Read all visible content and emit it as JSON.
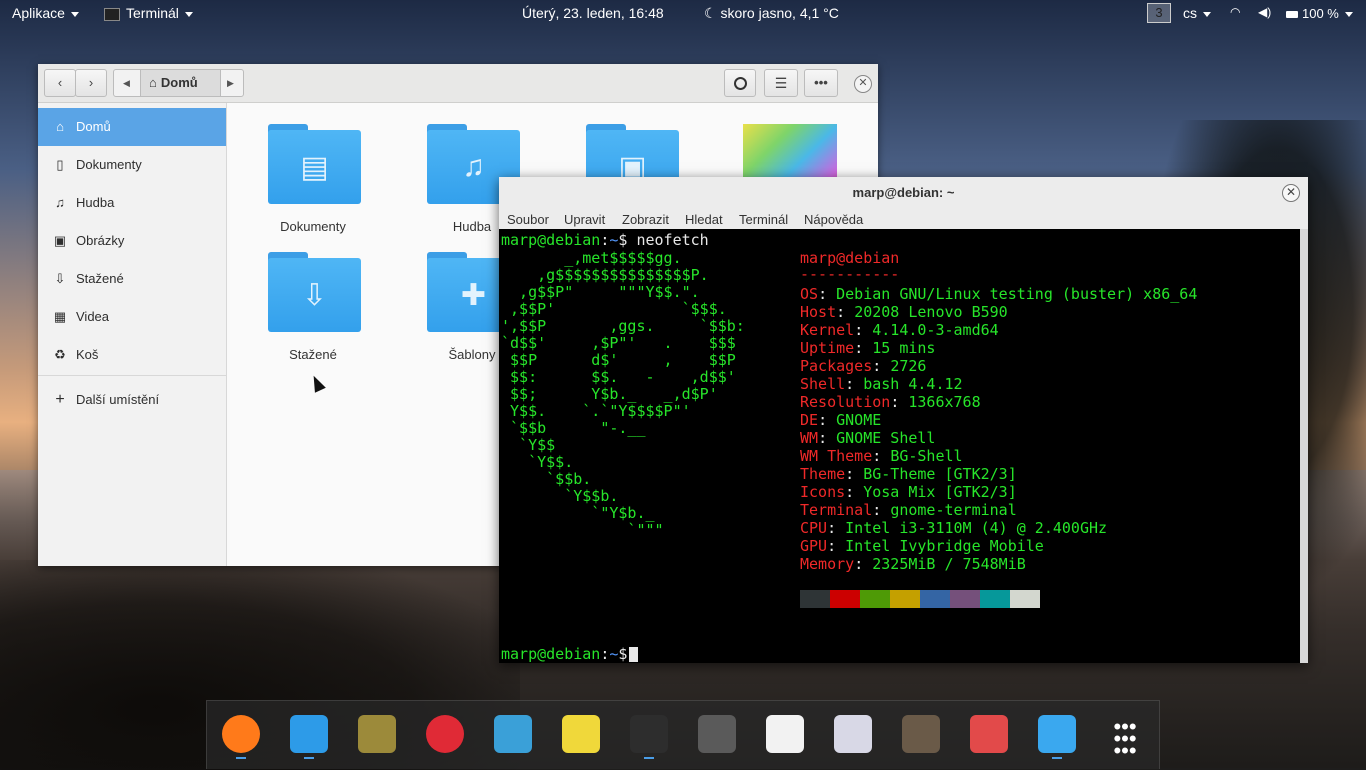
{
  "topbar": {
    "apps_menu": "Aplikace",
    "active_app": "Terminál",
    "datetime": "Úterý, 23. leden, 16:48",
    "weather": "skoro jasno, 4,1 °C",
    "workspace": "3",
    "keyboard": "cs",
    "battery": "100 %"
  },
  "files": {
    "path_current": "Domů",
    "sidebar": [
      {
        "label": "Domů",
        "icon": "home-icon",
        "active": true
      },
      {
        "label": "Dokumenty",
        "icon": "document-icon"
      },
      {
        "label": "Hudba",
        "icon": "music-icon"
      },
      {
        "label": "Obrázky",
        "icon": "image-icon"
      },
      {
        "label": "Stažené",
        "icon": "download-icon"
      },
      {
        "label": "Videa",
        "icon": "video-icon"
      },
      {
        "label": "Koš",
        "icon": "trash-icon"
      }
    ],
    "other_locations": "Další umístění",
    "folders": [
      {
        "label": "Dokumenty",
        "icon": "document-icon"
      },
      {
        "label": "Hudba",
        "icon": "music-icon"
      },
      {
        "label": "",
        "icon": "image-icon"
      },
      {
        "label": "",
        "icon": "wallpaper-thumbnail"
      },
      {
        "label": "Stažené",
        "icon": "download-icon"
      },
      {
        "label": "Šablony",
        "icon": "puzzle-icon"
      }
    ]
  },
  "terminal": {
    "title": "marp@debian: ~",
    "menu": [
      "Soubor",
      "Upravit",
      "Zobrazit",
      "Hledat",
      "Terminál",
      "Nápověda"
    ],
    "prompt_user": "marp@debian",
    "prompt_sep": ":",
    "prompt_path": "~",
    "prompt_symbol": "$",
    "command": " neofetch",
    "logo": [
      "       _,met$$$$$gg.",
      "    ,g$$$$$$$$$$$$$$$P.",
      "  ,g$$P\"     \"\"\"Y$$.\".",
      " ,$$P'              `$$$.",
      "',$$P       ,ggs.     `$$b:",
      "`d$$'     ,$P\"'   .    $$$",
      " $$P      d$'     ,    $$P",
      " $$:      $$.   -    ,d$$'",
      " $$;      Y$b._   _,d$P'",
      " Y$$.    `.`\"Y$$$$P\"'",
      " `$$b      \"-.__",
      "  `Y$$",
      "   `Y$$.",
      "     `$$b.",
      "       `Y$$b.",
      "          `\"Y$b._",
      "              `\"\"\""
    ],
    "user_host": "marp@debian",
    "underline": "-----------",
    "info": [
      {
        "key": "OS",
        "value": "Debian GNU/Linux testing (buster) x86_64"
      },
      {
        "key": "Host",
        "value": "20208 Lenovo B590"
      },
      {
        "key": "Kernel",
        "value": "4.14.0-3-amd64"
      },
      {
        "key": "Uptime",
        "value": "15 mins"
      },
      {
        "key": "Packages",
        "value": "2726"
      },
      {
        "key": "Shell",
        "value": "bash 4.4.12"
      },
      {
        "key": "Resolution",
        "value": "1366x768"
      },
      {
        "key": "DE",
        "value": "GNOME"
      },
      {
        "key": "WM",
        "value": "GNOME Shell"
      },
      {
        "key": "WM Theme",
        "value": "BG-Shell"
      },
      {
        "key": "Theme",
        "value": "BG-Theme [GTK2/3]"
      },
      {
        "key": "Icons",
        "value": "Yosa Mix [GTK2/3]"
      },
      {
        "key": "Terminal",
        "value": "gnome-terminal"
      },
      {
        "key": "CPU",
        "value": "Intel i3-3110M (4) @ 2.400GHz"
      },
      {
        "key": "GPU",
        "value": "Intel Ivybridge Mobile"
      },
      {
        "key": "Memory",
        "value": "2325MiB / 7548MiB"
      }
    ],
    "palette": [
      "#2e3436",
      "#cc0000",
      "#4e9a06",
      "#c4a000",
      "#3465a4",
      "#75507b",
      "#06989a",
      "#d3d7cf"
    ]
  },
  "dock": [
    {
      "name": "firefox",
      "color": "#ff7a1a",
      "running": true
    },
    {
      "name": "mail",
      "color": "#2d9be8",
      "running": true
    },
    {
      "name": "gimp",
      "color": "#9c8a3a",
      "running": false
    },
    {
      "name": "music",
      "color": "#e02a36",
      "running": false
    },
    {
      "name": "maps",
      "color": "#3aa0d8",
      "running": false
    },
    {
      "name": "text-editor",
      "color": "#f0d83a",
      "running": false
    },
    {
      "name": "terminal",
      "color": "#2d2d2d",
      "running": true
    },
    {
      "name": "settings",
      "color": "#5a5a5a",
      "running": false
    },
    {
      "name": "software",
      "color": "#f2f2f2",
      "running": false
    },
    {
      "name": "installer",
      "color": "#d8d8e6",
      "running": false
    },
    {
      "name": "calculator",
      "color": "#6a5a48",
      "running": false
    },
    {
      "name": "screenshot",
      "color": "#e24a4a",
      "running": false
    },
    {
      "name": "files",
      "color": "#3aa8ef",
      "running": true
    },
    {
      "name": "app-grid",
      "color": "transparent",
      "running": false
    }
  ]
}
